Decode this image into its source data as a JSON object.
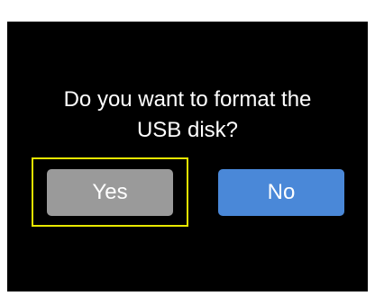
{
  "dialog": {
    "message_line1": "Do you want to format the",
    "message_line2": "USB disk?",
    "yes_label": "Yes",
    "no_label": "No",
    "selected_button": "Yes"
  },
  "colors": {
    "background": "#000000",
    "text": "#ffffff",
    "yes_button": "#9a9a9a",
    "no_button": "#4a88d8",
    "focus_frame": "#e8e800"
  }
}
